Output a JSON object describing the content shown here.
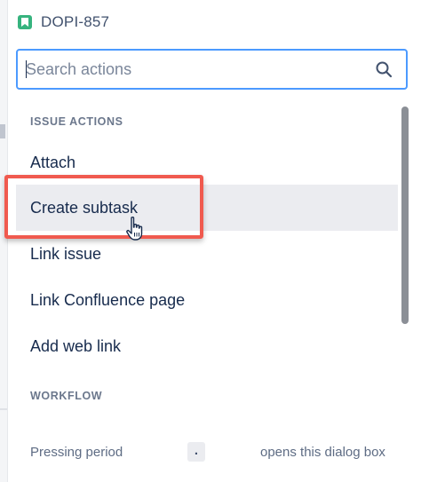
{
  "header": {
    "issue_key": "DOPI-857",
    "issue_icon": "story-bookmark-icon",
    "issue_icon_color": "#36b37e"
  },
  "search": {
    "placeholder": "Search actions",
    "value": "",
    "icon": "search-icon",
    "focus_color": "#4c9aff"
  },
  "sections": [
    {
      "heading": "ISSUE ACTIONS",
      "items": [
        {
          "label": "Attach"
        },
        {
          "label": "Create subtask",
          "hovered": true
        },
        {
          "label": "Link issue"
        },
        {
          "label": "Link Confluence page"
        },
        {
          "label": "Add web link"
        }
      ]
    },
    {
      "heading": "WORKFLOW",
      "items": []
    }
  ],
  "footer": {
    "text_before": "Pressing period",
    "key": ".",
    "text_after": "opens this dialog box"
  },
  "annotation": {
    "highlight_color": "#f05a4f",
    "cursor": "pointer-hand-icon"
  },
  "colors": {
    "text": "#172b4d",
    "subtle_text": "#6b778c",
    "hover_bg": "#ebecf0"
  }
}
